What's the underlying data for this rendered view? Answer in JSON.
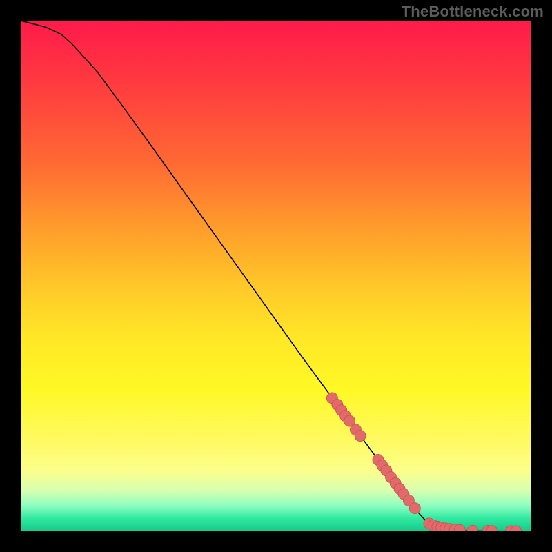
{
  "watermark": "TheBottleneck.com",
  "chart_data": {
    "type": "line",
    "title": "",
    "xlabel": "",
    "ylabel": "",
    "xlim": [
      0,
      100
    ],
    "ylim": [
      0,
      100
    ],
    "grid": false,
    "series": [
      {
        "name": "curve",
        "kind": "line",
        "x": [
          0,
          2,
          5,
          8,
          10,
          15,
          20,
          25,
          30,
          35,
          40,
          45,
          50,
          55,
          60,
          62,
          64,
          66,
          68,
          70,
          72,
          74,
          76,
          78,
          79,
          80,
          82,
          85,
          88,
          92,
          96,
          100
        ],
        "y": [
          100,
          99.5,
          98.7,
          97.3,
          95.5,
          90,
          83.2,
          76.3,
          69.3,
          62.3,
          55.3,
          48.3,
          41.3,
          34.3,
          27.5,
          24.8,
          22.1,
          19.4,
          16.7,
          14.0,
          11.3,
          8.6,
          6.0,
          3.5,
          2.4,
          1.5,
          0.7,
          0.25,
          0.1,
          0.05,
          0.02,
          0
        ]
      },
      {
        "name": "highlight-dots",
        "kind": "scatter",
        "x": [
          61.0,
          62.0,
          62.8,
          63.6,
          64.4,
          65.6,
          66.5,
          70.0,
          70.8,
          71.6,
          72.5,
          73.4,
          74.2,
          75.0,
          76.0,
          77.2,
          80.0,
          80.8,
          81.6,
          82.4,
          83.2,
          84.0,
          85.0,
          86.0,
          88.5,
          91.5,
          92.3,
          96.0,
          97.0
        ],
        "y": [
          26.1,
          24.8,
          23.7,
          22.6,
          21.6,
          19.9,
          18.7,
          14.0,
          12.9,
          11.9,
          10.6,
          9.4,
          8.3,
          7.3,
          6.0,
          4.5,
          1.5,
          1.15,
          0.9,
          0.72,
          0.56,
          0.43,
          0.3,
          0.22,
          0.1,
          0.06,
          0.05,
          0.02,
          0.018
        ]
      }
    ],
    "marker_radius": 8
  }
}
